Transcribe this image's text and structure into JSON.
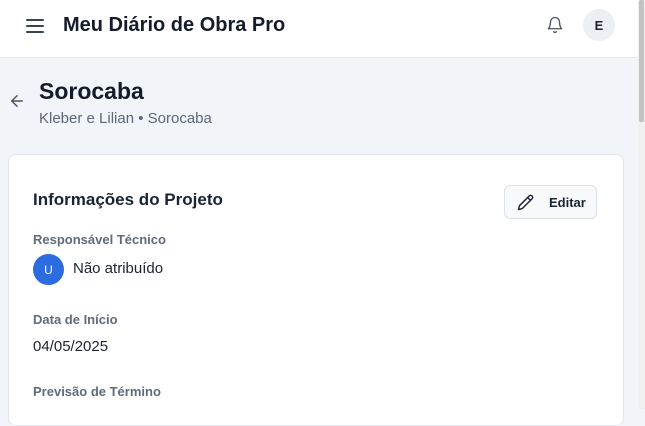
{
  "header": {
    "title": "Meu Diário de Obra Pro",
    "menu_icon": "hamburger-menu-icon",
    "notifications_icon": "bell-icon",
    "avatar_initial": "E"
  },
  "project": {
    "back_icon": "arrow-left-icon",
    "title": "Sorocaba",
    "subtitle": "Kleber e Lilian • Sorocaba"
  },
  "info_card": {
    "title": "Informações do Projeto",
    "edit_label": "Editar",
    "edit_icon": "pencil-icon",
    "responsible": {
      "label": "Responsável Técnico",
      "avatar_initial": "U",
      "value": "Não atribuído"
    },
    "start_date": {
      "label": "Data de Início",
      "value": "04/05/2025"
    },
    "end_forecast": {
      "label": "Previsão de Término"
    }
  },
  "colors": {
    "background": "#f1f4f8",
    "card": "#ffffff",
    "accent": "#2d6be0",
    "text": "#1a2333",
    "muted": "#5f6b7b"
  }
}
